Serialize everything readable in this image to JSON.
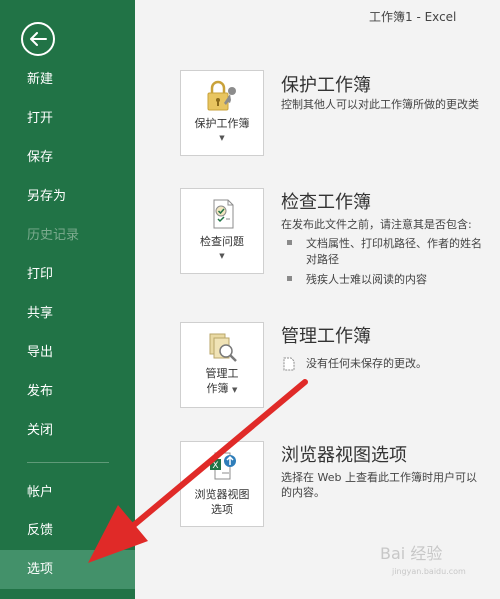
{
  "window": {
    "title": "工作簿1  -  Excel"
  },
  "sidebar": {
    "back_label": "",
    "items": [
      {
        "label": "新建"
      },
      {
        "label": "打开"
      },
      {
        "label": "保存"
      },
      {
        "label": "另存为"
      },
      {
        "label": "历史记录"
      },
      {
        "label": "打印"
      },
      {
        "label": "共享"
      },
      {
        "label": "导出"
      },
      {
        "label": "发布"
      },
      {
        "label": "关闭"
      },
      {
        "label": "帐户"
      },
      {
        "label": "反馈"
      },
      {
        "label": "选项"
      }
    ]
  },
  "sections": {
    "protect": {
      "button_label": "保护工作簿",
      "title": "保护工作簿",
      "description": "控制其他人可以对此工作簿所做的更改类"
    },
    "inspect": {
      "button_label": "检查问题",
      "title": "检查工作簿",
      "description": "在发布此文件之前，请注意其是否包含:",
      "bullets": [
        {
          "line1": "文档属性、打印机路径、作者的姓名",
          "line2": "对路径"
        },
        {
          "line1": "残疾人士难以阅读的内容"
        }
      ]
    },
    "manage": {
      "button_line1": "管理工",
      "button_line2": "作簿",
      "title": "管理工作簿",
      "status": "没有任何未保存的更改。"
    },
    "browser": {
      "button_line1": "浏览器视图",
      "button_line2": "选项",
      "title": "浏览器视图选项",
      "description_line1": "选择在 Web 上查看此工作簿时用户可以",
      "description_line2": "的内容。"
    }
  },
  "watermark": {
    "text": "Bai 经验",
    "sub": "jingyan.baidu.com"
  },
  "colors": {
    "sidebar": "#217346",
    "selected": "#43916a",
    "arrow": "#e02a28"
  }
}
